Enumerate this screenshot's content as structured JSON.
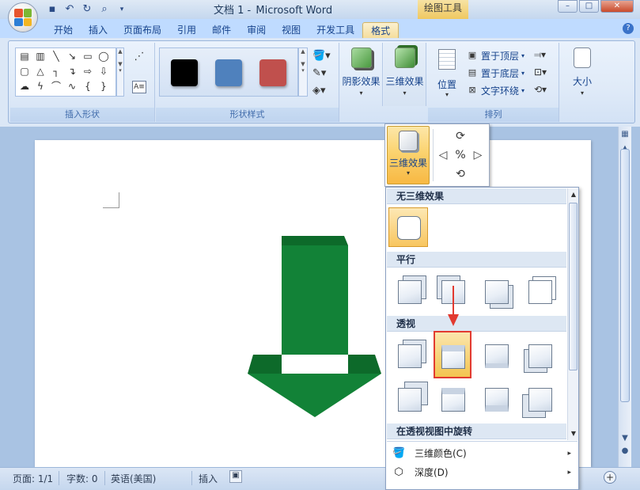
{
  "window": {
    "title": "文档 1",
    "title_sep": " - ",
    "app_name": "Microsoft Word",
    "context_tab_title": "绘图工具",
    "minimize": "–",
    "maximize": "□",
    "close": "✕"
  },
  "tabs": [
    {
      "label": "开始"
    },
    {
      "label": "插入"
    },
    {
      "label": "页面布局"
    },
    {
      "label": "引用"
    },
    {
      "label": "邮件"
    },
    {
      "label": "审阅"
    },
    {
      "label": "视图"
    },
    {
      "label": "开发工具"
    },
    {
      "label": "格式"
    }
  ],
  "ribbon": {
    "insert_shapes_label": "插入形状",
    "shape_styles_label": "形状样式",
    "shadow_effects_label": "阴影效果",
    "three_d_effects_label": "三维效果",
    "arrange_label": "排列",
    "position_label": "位置",
    "bring_front_label": "置于顶层",
    "send_back_label": "置于底层",
    "text_wrap_label": "文字环绕",
    "size_label": "大小",
    "style_colors": [
      "#000000",
      "#4f81bd",
      "#c0504d"
    ]
  },
  "popup": {
    "three_d_button_label": "三维效果"
  },
  "dropdown": {
    "sections": {
      "no_3d": "无三维效果",
      "parallel": "平行",
      "perspective": "透视",
      "rotate_in_perspective": "在透视视图中旋转"
    },
    "menu_items": [
      {
        "label": "三维颜色(C)"
      },
      {
        "label": "深度(D)"
      }
    ]
  },
  "document": {
    "arrow_color": "#128237",
    "arrow_dark_color": "#0d6a2a"
  },
  "status": {
    "page": "页面: 1/1",
    "words": "字数: 0",
    "language": "英语(美国)",
    "insert_mode": "插入"
  },
  "annotation": {
    "arrow_color": "#e23a30"
  }
}
